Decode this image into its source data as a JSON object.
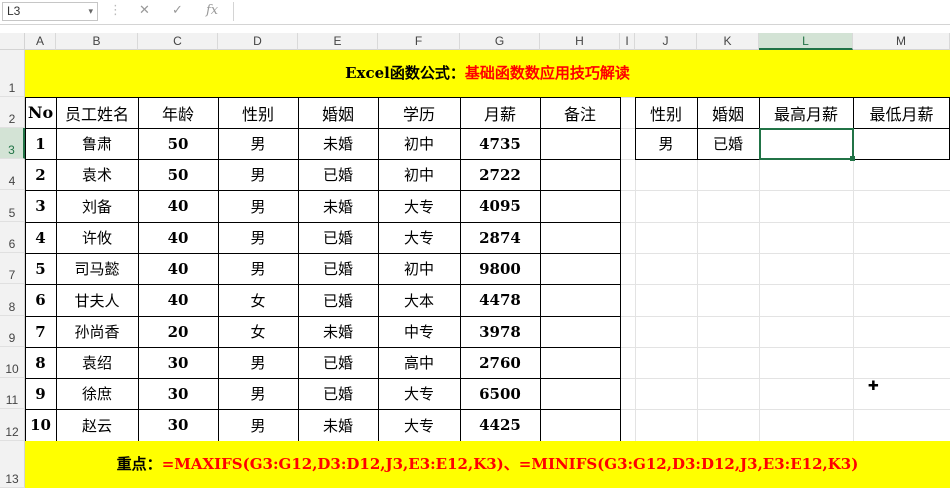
{
  "formula_bar": {
    "name_box": "L3",
    "cancel_icon": "✕",
    "enter_icon": "✓",
    "fx_label": "fx"
  },
  "columns": [
    "A",
    "B",
    "C",
    "D",
    "E",
    "F",
    "G",
    "H",
    "I",
    "J",
    "K",
    "L",
    "M"
  ],
  "selected_column": "L",
  "rows": [
    "1",
    "2",
    "3",
    "4",
    "5",
    "6",
    "7",
    "8",
    "9",
    "10",
    "11",
    "12",
    "13"
  ],
  "selected_row": "3",
  "title": {
    "part1": "Excel函数公式：",
    "part2": "基础函数数应用技巧解读",
    "color1": "#000000",
    "color2": "#ff0000"
  },
  "table": {
    "headers": [
      "No",
      "员工姓名",
      "年龄",
      "性别",
      "婚姻",
      "学历",
      "月薪",
      "备注"
    ],
    "rows": [
      [
        "1",
        "鲁肃",
        "50",
        "男",
        "未婚",
        "初中",
        "4735",
        ""
      ],
      [
        "2",
        "袁术",
        "50",
        "男",
        "已婚",
        "初中",
        "2722",
        ""
      ],
      [
        "3",
        "刘备",
        "40",
        "男",
        "未婚",
        "大专",
        "4095",
        ""
      ],
      [
        "4",
        "许攸",
        "40",
        "男",
        "已婚",
        "大专",
        "2874",
        ""
      ],
      [
        "5",
        "司马懿",
        "40",
        "男",
        "已婚",
        "初中",
        "9800",
        ""
      ],
      [
        "6",
        "甘夫人",
        "40",
        "女",
        "已婚",
        "大本",
        "4478",
        ""
      ],
      [
        "7",
        "孙尚香",
        "20",
        "女",
        "未婚",
        "中专",
        "3978",
        ""
      ],
      [
        "8",
        "袁绍",
        "30",
        "男",
        "已婚",
        "高中",
        "2760",
        ""
      ],
      [
        "9",
        "徐庶",
        "30",
        "男",
        "已婚",
        "大专",
        "6500",
        ""
      ],
      [
        "10",
        "赵云",
        "30",
        "男",
        "未婚",
        "大专",
        "4425",
        ""
      ]
    ]
  },
  "query": {
    "headers": [
      "性别",
      "婚姻",
      "最高月薪",
      "最低月薪"
    ],
    "values": [
      "男",
      "已婚",
      "",
      ""
    ]
  },
  "footer": {
    "label": "重点：",
    "formula": "=MAXIFS(G3:G12,D3:D12,J3,E3:E12,K3)、=MINIFS(G3:G12,D3:D12,J3,E3:E12,K3)",
    "label_color": "#000000",
    "formula_color": "#ff0000"
  },
  "colors": {
    "banner": "#ffff00",
    "selection": "#217346"
  }
}
